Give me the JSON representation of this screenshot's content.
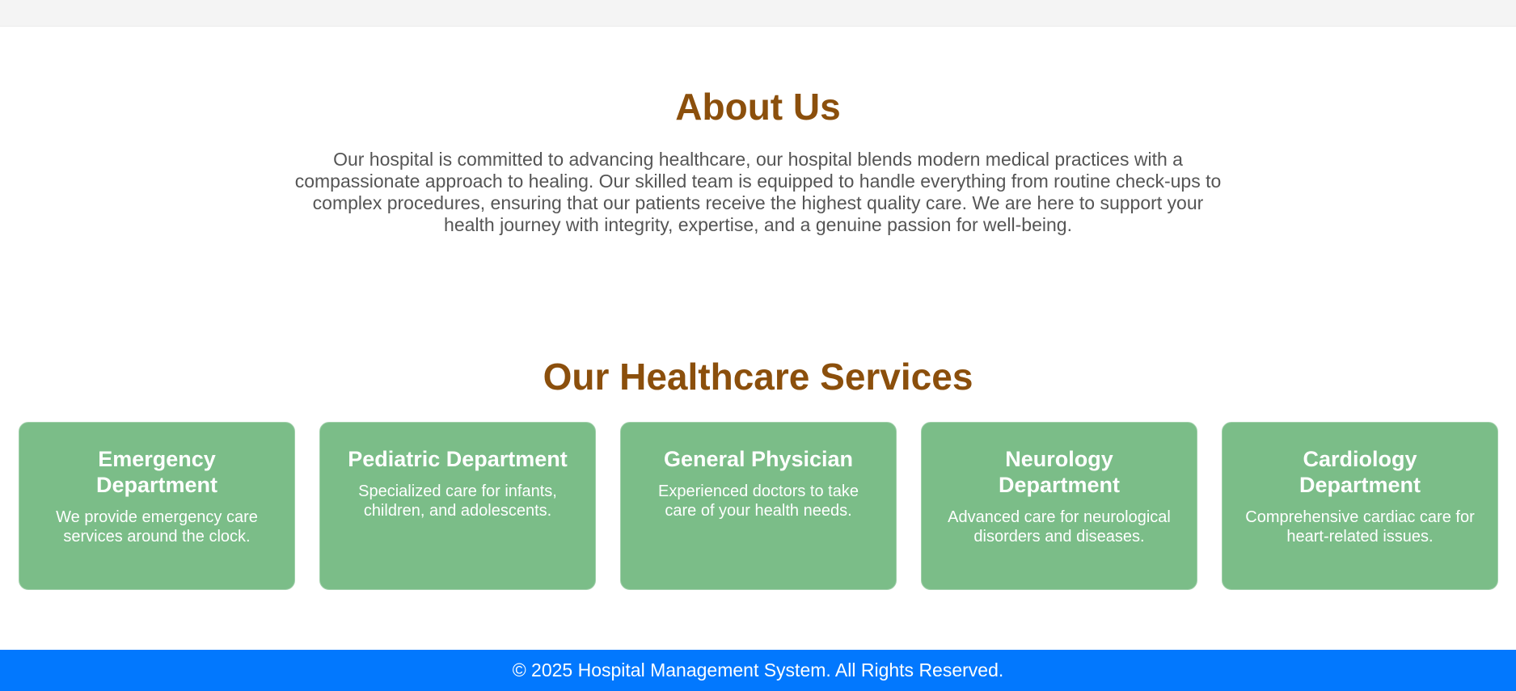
{
  "about": {
    "title": "About Us",
    "text": "Our hospital is committed to advancing healthcare, our hospital blends modern medical practices with a compassionate approach to healing. Our skilled team is equipped to handle everything from routine check-ups to complex procedures, ensuring that our patients receive the highest quality care. We are here to support your health journey with integrity, expertise, and a genuine passion for well-being."
  },
  "services": {
    "title": "Our Healthcare Services",
    "cards": [
      {
        "title": "Emergency Department",
        "desc": "We provide emergency care services around the clock."
      },
      {
        "title": "Pediatric Department",
        "desc": "Specialized care for infants, children, and adolescents."
      },
      {
        "title": "General Physician",
        "desc": "Experienced doctors to take care of your health needs."
      },
      {
        "title": "Neurology Department",
        "desc": "Advanced care for neurological disorders and diseases."
      },
      {
        "title": "Cardiology Department",
        "desc": "Comprehensive cardiac care for heart-related issues."
      }
    ]
  },
  "footer": {
    "text": "© 2025 Hospital Management System. All Rights Reserved."
  },
  "colors": {
    "heading": "#8b4f0c",
    "card_bg": "#7bbd88",
    "footer_bg": "#0278fe",
    "body_text": "#555555"
  }
}
